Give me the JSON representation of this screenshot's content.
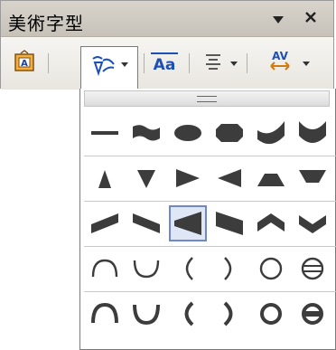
{
  "window": {
    "title": "美術字型",
    "dropdown_icon": "triangle-down-icon",
    "close_icon": "close-icon"
  },
  "toolbar": {
    "buttons": [
      {
        "name": "wordart-gallery-button",
        "icon": "wordart-gallery-icon"
      },
      {
        "name": "wordart-shape-button",
        "icon": "wordart-shape-icon",
        "has_dropdown": true,
        "active": true
      },
      {
        "name": "same-letter-heights-button",
        "icon": "letter-heights-icon",
        "label": "Aa"
      },
      {
        "name": "alignment-button",
        "icon": "align-center-icon",
        "has_dropdown": true
      },
      {
        "name": "character-spacing-button",
        "icon": "character-spacing-icon",
        "label": "AV",
        "has_dropdown": true
      }
    ]
  },
  "gallery": {
    "selected": {
      "row": 2,
      "col": 2
    },
    "rows": [
      [
        "plain-text-shape",
        "wave-shape",
        "ellipse-shape",
        "octagon-shape",
        "cup-down-shape",
        "cup-shape"
      ],
      [
        "triangle-up-shape",
        "triangle-down-shape",
        "triangle-right-shape",
        "triangle-left-shape",
        "chevron-up-shape",
        "chevron-down-shape"
      ],
      [
        "slant-up-shape",
        "slant-down-shape",
        "slant-fade-shape",
        "fade-right-shape",
        "arch-up-shape",
        "arch-down-shape"
      ],
      [
        "arch-up-curve-shape",
        "arch-down-curve-shape",
        "paren-left-shape",
        "paren-right-shape",
        "circle-shape",
        "button-shape"
      ],
      [
        "arch-up-pour-shape",
        "arch-down-pour-shape",
        "paren-left-pour-shape",
        "paren-right-pour-shape",
        "circle-pour-shape",
        "button-pour-shape"
      ]
    ]
  },
  "colors": {
    "shape_fill": "#3c3c3c",
    "selection_border": "#6f89c8",
    "selection_fill": "#dfe6f5"
  }
}
